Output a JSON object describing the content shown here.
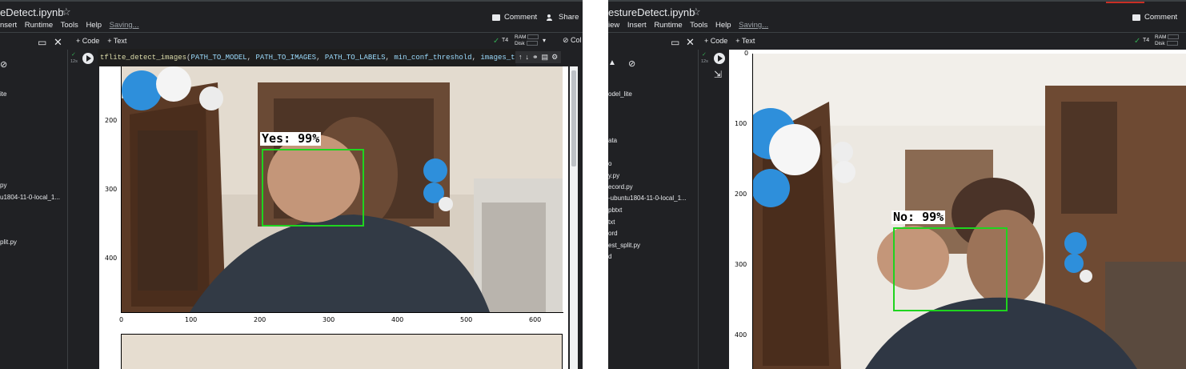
{
  "colors": {
    "bg": "#202124",
    "text": "#e8eaed",
    "detect_box": "#1fd41f",
    "check": "#34a853"
  },
  "left": {
    "title": "eDetect.ipynb",
    "menu": [
      "nsert",
      "Runtime",
      "Tools",
      "Help"
    ],
    "saving": "Saving...",
    "comment_label": "Comment",
    "share_label": "Share",
    "add_code": "+ Code",
    "add_text": "+ Text",
    "runtime": "T4",
    "ram_label": "RAM",
    "disk_label": "Disk",
    "connect_fragment": "Col",
    "run_count": "12s",
    "code": {
      "fn": "tflite_detect_images",
      "args": [
        "PATH_TO_MODEL",
        "PATH_TO_IMAGES",
        "PATH_TO_LABELS",
        "min_conf_threshold",
        "images_to_test"
      ]
    },
    "files": [
      "ite",
      "py",
      "u1804-11-0-local_1...",
      "plit.py"
    ],
    "detection_label": "Yes: 99%",
    "y_ticks": [
      "200",
      "300",
      "400"
    ],
    "x_ticks": [
      "0",
      "100",
      "200",
      "300",
      "400",
      "500",
      "600"
    ]
  },
  "right": {
    "title": "estureDetect.ipynb",
    "menu": [
      "iew",
      "Insert",
      "Runtime",
      "Tools",
      "Help"
    ],
    "saving": "Saving...",
    "comment_label": "Comment",
    "add_code": "+ Code",
    "add_text": "+ Text",
    "runtime": "T4",
    "ram_label": "RAM",
    "disk_label": "Disk",
    "run_count": "12s",
    "files": [
      "odel_lite",
      "ata",
      "o",
      "y.py",
      "ecord.py",
      "-ubuntu1804-11-0-local_1...",
      "pbtxt",
      "txt",
      "ord",
      "est_split.py",
      "d"
    ],
    "detection_label": "No: 99%",
    "y_ticks": [
      "0",
      "100",
      "200",
      "300",
      "400"
    ]
  }
}
